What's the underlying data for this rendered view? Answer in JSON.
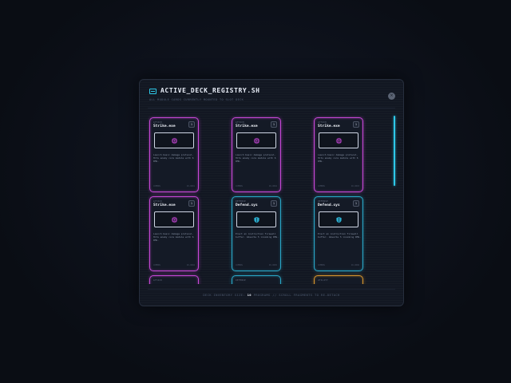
{
  "modal": {
    "title": "ACTIVE_DECK_REGISTRY.SH",
    "subtitle": "ALL MODULE CARDS CURRENTLY MOUNTED TO SLOT DECK",
    "close_label": "×"
  },
  "cards": [
    {
      "type_label": "ATTACK",
      "name": "Strike.exe",
      "cost": "1",
      "desc": "Launch basic damage protocol. Hits enemy core module with 6 DMG.",
      "foot_left": "COMMON",
      "foot_right": "ID-0001",
      "icon": "chip-icon",
      "color": "#c847d8"
    },
    {
      "type_label": "ATTACK",
      "name": "Strike.exe",
      "cost": "1",
      "desc": "Launch basic damage protocol. Hits enemy core module with 6 DMG.",
      "foot_left": "COMMON",
      "foot_right": "ID-0002",
      "icon": "chip-icon",
      "color": "#c847d8"
    },
    {
      "type_label": "ATTACK",
      "name": "Strike.exe",
      "cost": "1",
      "desc": "Launch basic damage protocol. Hits enemy core module with 6 DMG.",
      "foot_left": "COMMON",
      "foot_right": "ID-0003",
      "icon": "chip-icon",
      "color": "#c847d8"
    },
    {
      "type_label": "ATTACK",
      "name": "Strike.exe",
      "cost": "1",
      "desc": "Launch basic damage protocol. Hits enemy core module with 6 DMG.",
      "foot_left": "COMMON",
      "foot_right": "ID-0004",
      "icon": "chip-icon",
      "color": "#c847d8"
    },
    {
      "type_label": "DEFENSE",
      "name": "Defend.sys",
      "cost": "1",
      "desc": "Erect an instruction firewall buffer. Absorbs 5 incoming DMG.",
      "foot_left": "COMMON",
      "foot_right": "ID-0005",
      "icon": "shield-icon",
      "color": "#2aa9c9"
    },
    {
      "type_label": "DEFENSE",
      "name": "Defend.sys",
      "cost": "1",
      "desc": "Erect an instruction firewall buffer. Absorbs 5 incoming DMG.",
      "foot_left": "COMMON",
      "foot_right": "ID-0006",
      "icon": "shield-icon",
      "color": "#2aa9c9"
    },
    {
      "type_label": "ATTACK",
      "name": "",
      "cost": "",
      "desc": "",
      "foot_left": "",
      "foot_right": "",
      "icon": "",
      "color": "#c847d8"
    },
    {
      "type_label": "DEFENSE",
      "name": "",
      "cost": "",
      "desc": "",
      "foot_left": "",
      "foot_right": "",
      "icon": "",
      "color": "#2aa9c9"
    },
    {
      "type_label": "UTILITY",
      "name": "",
      "cost": "",
      "desc": "",
      "foot_left": "",
      "foot_right": "",
      "icon": "",
      "color": "#d8962e"
    }
  ],
  "footer": {
    "prefix": "DECK INVENTORY SIZE:",
    "count": "10",
    "suffix": "PROGRAMS // SCROLL FRAGMENTS TO RE-DETACH"
  },
  "colors": {
    "accent": "#2ec8e8",
    "attack": "#c847d8",
    "defense": "#2aa9c9",
    "utility": "#d8962e"
  }
}
